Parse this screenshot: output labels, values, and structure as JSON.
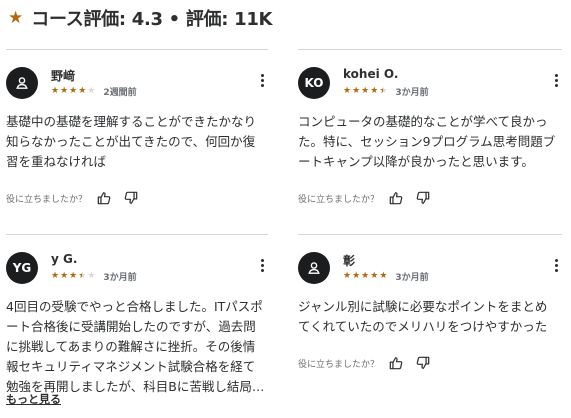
{
  "header": {
    "star_icon": "star-icon",
    "title": "コース評価: 4.3 • 評価: 11K"
  },
  "colors": {
    "star": "#b4690e",
    "avatar": "#1c1d1f",
    "text": "#2d2f31",
    "muted": "#6a6f73"
  },
  "reviews": [
    {
      "avatar": {
        "type": "icon",
        "icon": "user-icon",
        "initials": ""
      },
      "name": "野﨑",
      "rating": 4,
      "date": "2週間前",
      "lines": [
        "基礎中の基礎を理解することができたかなり",
        "知らなかったことが出てきたので、何回か復",
        "習を重ねなければ"
      ],
      "helpful_label": "役に立ちましたか？"
    },
    {
      "avatar": {
        "type": "initials",
        "icon": "",
        "initials": "KO"
      },
      "name": "kohei O.",
      "rating": 4.5,
      "date": "3か月前",
      "lines": [
        "コンピュータの基礎的なことが学べて良かっ",
        "た。特に、セッション9プログラム思考問題ブ",
        "ートキャンプ以降が良かったと思います。"
      ],
      "helpful_label": "役に立ちましたか？"
    },
    {
      "avatar": {
        "type": "initials",
        "icon": "",
        "initials": "YG"
      },
      "name": "y G.",
      "rating": 3.5,
      "date": "3か月前",
      "lines": [
        "4回目の受験でやっと合格しました。ITパスポ",
        "ート合格後に受講開始したのですが、過去問",
        "に挑戦してあまりの難解さに挫折。その後情",
        "報セキュリティマネジメント試験合格を経て",
        "勉強を再開しましたが、科目Bに苦戦し結局…"
      ],
      "helpful_label": "",
      "show_more": "もっと見る"
    },
    {
      "avatar": {
        "type": "icon",
        "icon": "user-icon",
        "initials": ""
      },
      "name": "彰",
      "rating": 5,
      "date": "3か月前",
      "lines": [
        "ジャンル別に試験に必要なポイントをまとめ",
        "てくれていたのでメリハリをつけやすかった"
      ],
      "helpful_label": "役に立ちましたか？"
    }
  ]
}
